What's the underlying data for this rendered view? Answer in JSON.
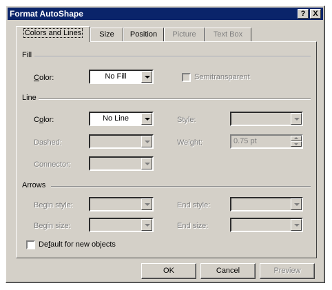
{
  "window": {
    "title": "Format AutoShape",
    "help_label": "?",
    "close_label": "X"
  },
  "tabs": [
    {
      "label": "Colors and Lines",
      "state": "active"
    },
    {
      "label": "Size",
      "state": "enabled"
    },
    {
      "label": "Position",
      "state": "enabled"
    },
    {
      "label": "Picture",
      "state": "disabled"
    },
    {
      "label": "Text Box",
      "state": "disabled"
    }
  ],
  "fill": {
    "section_label": "Fill",
    "color_label_pre": "",
    "color_label_key": "C",
    "color_label_post": "olor:",
    "color_value": "No Fill",
    "semitransparent_label": "Semitransparent",
    "semitransparent_checked": false
  },
  "line": {
    "section_label": "Line",
    "color_label_pre": "C",
    "color_label_key": "o",
    "color_label_post": "lor:",
    "color_value": "No Line",
    "style_label": "Style:",
    "dashed_label": "Dashed:",
    "weight_label": "Weight:",
    "weight_value": "0.75 pt",
    "connector_label": "Connector:"
  },
  "arrows": {
    "section_label": "Arrows",
    "begin_style_label": "Begin style:",
    "end_style_label": "End style:",
    "begin_size_label": "Begin size:",
    "end_size_label": "End size:"
  },
  "default_checkbox": {
    "label_pre": "De",
    "label_key": "f",
    "label_post": "ault for new objects",
    "checked": false
  },
  "buttons": {
    "ok": "OK",
    "cancel": "Cancel",
    "preview": "Preview"
  }
}
